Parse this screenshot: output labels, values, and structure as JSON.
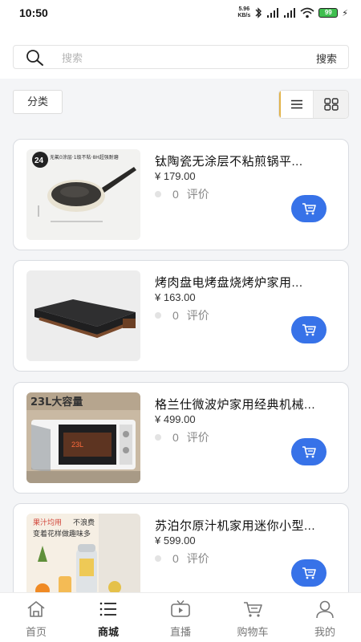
{
  "status": {
    "time": "10:50",
    "net_speed_value": "5.96",
    "net_speed_unit": "KB/s",
    "battery": "99"
  },
  "search": {
    "placeholder": "搜索",
    "button_label": "搜索"
  },
  "toolbar": {
    "category_label": "分类",
    "view_modes": [
      "list",
      "grid"
    ],
    "active_view": "list"
  },
  "products": [
    {
      "name": "钛陶瓷无涂层不粘煎锅平...",
      "price": "¥ 179.00",
      "review_count": "0",
      "review_label": "评价"
    },
    {
      "name": "烤肉盘电烤盘烧烤炉家用...",
      "price": "¥ 163.00",
      "review_count": "0",
      "review_label": "评价"
    },
    {
      "name": "格兰仕微波炉家用经典机械...",
      "price": "¥ 499.00",
      "review_count": "0",
      "review_label": "评价"
    },
    {
      "name": "苏泊尔原汁机家用迷你小型...",
      "price": "¥ 599.00",
      "review_count": "0",
      "review_label": "评价"
    }
  ],
  "product_images": {
    "pan_badge": "24",
    "pan_text": "无氟0涂层·1级不粘·8H超强耐磨",
    "microwave_badge": "23L大容量",
    "microwave_door": "23L",
    "juicer_line1": "果汁均用",
    "juicer_line2": "不浪费",
    "juicer_line3": "变着花样做趣味多"
  },
  "tabbar": {
    "items": [
      {
        "label": "首页",
        "icon": "home-icon"
      },
      {
        "label": "商城",
        "icon": "list-icon"
      },
      {
        "label": "直播",
        "icon": "tv-icon"
      },
      {
        "label": "购物车",
        "icon": "cart-icon"
      },
      {
        "label": "我的",
        "icon": "user-icon"
      }
    ],
    "active_index": 1
  },
  "colors": {
    "accent": "#3772e8",
    "toggle_highlight": "#e2b34a"
  }
}
